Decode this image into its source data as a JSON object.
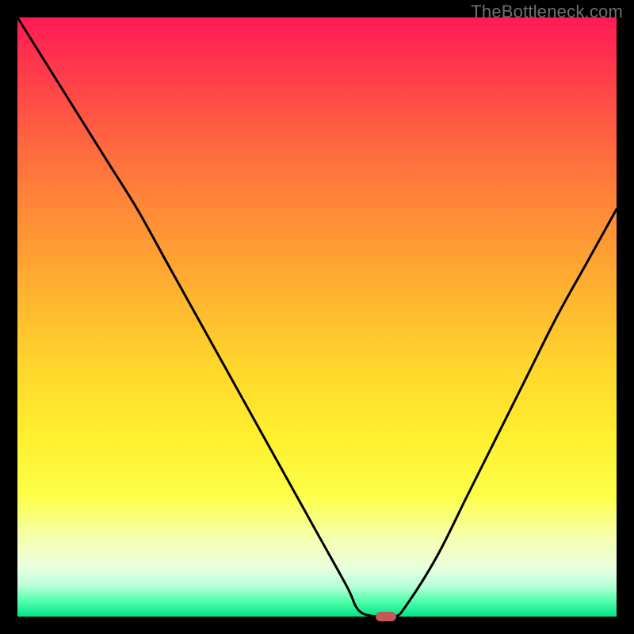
{
  "watermark": "TheBottleneck.com",
  "colors": {
    "frame": "#000000",
    "curve": "#000000",
    "marker": "#c35a56"
  },
  "chart_data": {
    "type": "line",
    "title": "",
    "xlabel": "",
    "ylabel": "",
    "xlim": [
      0,
      100
    ],
    "ylim": [
      0,
      100
    ],
    "grid": false,
    "legend": false,
    "annotations": [
      "TheBottleneck.com"
    ],
    "series": [
      {
        "name": "bottleneck-curve",
        "x": [
          0,
          5,
          10,
          15,
          20,
          25,
          30,
          35,
          40,
          45,
          50,
          55,
          57,
          60,
          63,
          65,
          70,
          75,
          80,
          85,
          90,
          95,
          100
        ],
        "y": [
          100,
          92,
          84,
          76,
          68,
          59,
          50,
          41,
          32,
          23,
          14,
          5,
          1,
          0,
          0,
          2,
          10,
          20,
          30,
          40,
          50,
          59,
          68
        ]
      }
    ],
    "marker": {
      "x": 61.5,
      "y": 0
    },
    "note": "Values are estimated from pixel positions; the chart has no visible axis ticks or numeric labels."
  }
}
